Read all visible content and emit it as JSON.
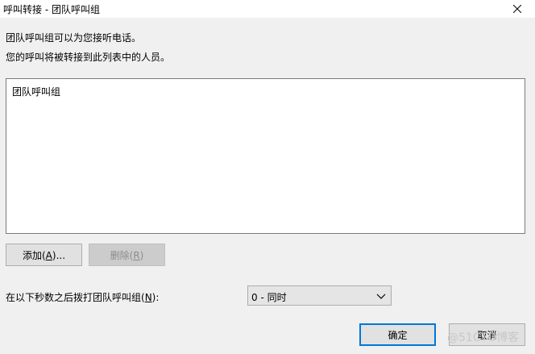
{
  "window": {
    "title": "呼叫转接 - 团队呼叫组",
    "close_icon": "close-icon"
  },
  "description": {
    "line1": "团队呼叫组可以为您接听电话。",
    "line2": "您的呼叫将被转接到此列表中的人员。"
  },
  "list": {
    "items": [
      {
        "label": "团队呼叫组"
      }
    ]
  },
  "buttons": {
    "add": "添加(A)...",
    "remove": "删除(R)",
    "ok": "确定",
    "cancel": "取消"
  },
  "ring_delay": {
    "label": "在以下秒数之后拨打团队呼叫组(N):",
    "selected": "0 - 同时",
    "dropdown_icon": "chevron-down-icon"
  },
  "watermark": "@51CTO博客",
  "colors": {
    "accent": "#0078d7",
    "background": "#f0f0f0"
  }
}
